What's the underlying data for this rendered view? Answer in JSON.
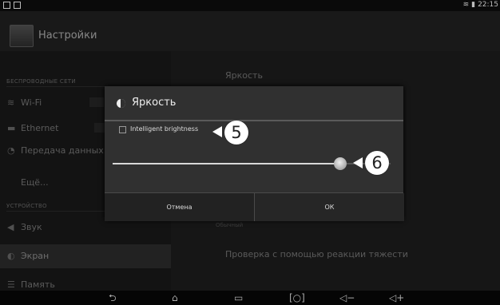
{
  "status_bar": {
    "time": "22:15"
  },
  "action_bar": {
    "title": "Настройки"
  },
  "left_pane": {
    "section_wireless": "БЕСПРОВОДНЫЕ СЕТИ",
    "section_device": "УСТРОЙСТВО",
    "items": [
      {
        "label": "Wi-Fi",
        "icon": "wifi-icon"
      },
      {
        "label": "Ethernet",
        "icon": "ethernet-icon"
      },
      {
        "label": "Передача данных",
        "icon": "data-usage-icon"
      },
      {
        "label": "Ещё..."
      },
      {
        "label": "Звук",
        "icon": "sound-icon"
      },
      {
        "label": "Экран",
        "icon": "display-icon",
        "selected": true
      },
      {
        "label": "Память",
        "icon": "storage-icon"
      }
    ]
  },
  "right_pane": {
    "brightness_label": "Яркость",
    "obscured_label": "Обычный",
    "gravity_label": "Проверка с помощью реакции тяжести"
  },
  "dialog": {
    "title": "Яркость",
    "checkbox_label": "Intelligent brightness",
    "checkbox_checked": false,
    "slider_level": 0.82,
    "cancel_label": "Отмена",
    "ok_label": "ОК"
  },
  "callouts": {
    "first": "5",
    "second": "6"
  },
  "nav_bar": {
    "icons": [
      "back-icon",
      "home-icon",
      "recent-apps-icon",
      "screenshot-icon",
      "volume-down-icon",
      "volume-up-icon"
    ]
  },
  "colors": {
    "dialog_bg": "#303030",
    "screen_bg": "#262626",
    "text": "#dddddd"
  }
}
